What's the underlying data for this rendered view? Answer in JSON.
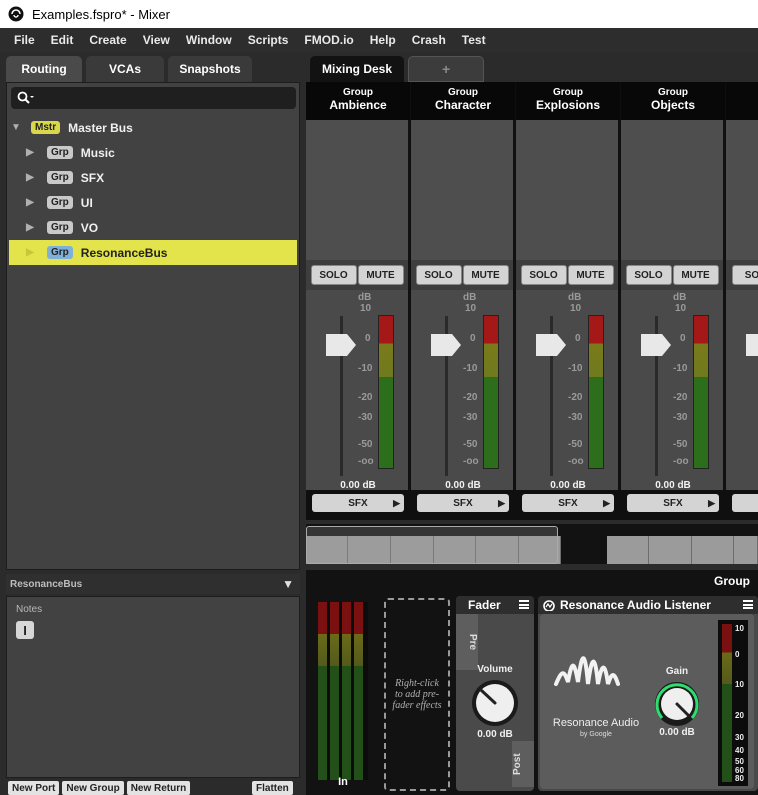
{
  "window": {
    "title": "Examples.fspro* - Mixer"
  },
  "menu": [
    "File",
    "Edit",
    "Create",
    "View",
    "Window",
    "Scripts",
    "FMOD.io",
    "Help",
    "Crash",
    "Test"
  ],
  "left_tabs": [
    "Routing",
    "VCAs",
    "Snapshots"
  ],
  "tree": [
    {
      "badge": "Mstr",
      "label": "Master Bus"
    },
    {
      "badge": "Grp",
      "label": "Music"
    },
    {
      "badge": "Grp",
      "label": "SFX"
    },
    {
      "badge": "Grp",
      "label": "UI"
    },
    {
      "badge": "Grp",
      "label": "VO"
    },
    {
      "badge": "Grp",
      "label": "ResonanceBus"
    }
  ],
  "selected_item": "ResonanceBus",
  "inspector": {
    "title": "ResonanceBus",
    "notes_label": "Notes",
    "notes_cursor": "I"
  },
  "buttons": {
    "new_port": "New Port",
    "new_group": "New Group",
    "new_return": "New Return",
    "flatten": "Flatten"
  },
  "right_tabs": {
    "active": "Mixing Desk",
    "add": "+"
  },
  "strips": [
    {
      "type": "Group",
      "name": "Ambience",
      "solo": "SOLO",
      "mute": "MUTE",
      "value": "0.00 dB",
      "route": "SFX"
    },
    {
      "type": "Group",
      "name": "Character",
      "solo": "SOLO",
      "mute": "MUTE",
      "value": "0.00 dB",
      "route": "SFX"
    },
    {
      "type": "Group",
      "name": "Explosions",
      "solo": "SOLO",
      "mute": "MUTE",
      "value": "0.00 dB",
      "route": "SFX"
    },
    {
      "type": "Group",
      "name": "Objects",
      "solo": "SOLO",
      "mute": "MUTE",
      "value": "0.00 dB",
      "route": "SFX"
    },
    {
      "type": "",
      "name": "",
      "solo": "SOL",
      "mute": "",
      "value": "",
      "route": ""
    }
  ],
  "fader_scale": [
    "dB",
    "10",
    "0",
    "-10",
    "-20",
    "-30",
    "-50",
    "-oo"
  ],
  "deck": {
    "header": "Group",
    "in_label": "In",
    "prefx_hint": "Right-click to add pre-fader effects",
    "fader_title": "Fader",
    "pre": "Pre",
    "post": "Post",
    "volume_label": "Volume",
    "volume_value": "0.00 dB",
    "listener_title": "Resonance Audio Listener",
    "brand_name": "Resonance Audio",
    "brand_by": "by Google",
    "gain_label": "Gain",
    "gain_value": "0.00 dB",
    "gain_scale": [
      "10",
      "0",
      "10",
      "20",
      "30",
      "40",
      "50",
      "60",
      "80"
    ]
  },
  "colors": {
    "selection": "#e3e34b",
    "meter_green": "#2d6e1c",
    "meter_red": "#a41818",
    "gain_ring": "#2fdc6f"
  }
}
